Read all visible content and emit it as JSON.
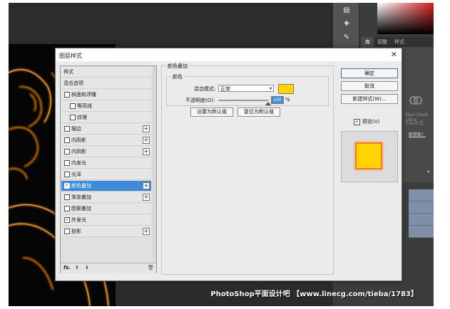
{
  "dialog": {
    "title": "图层样式",
    "close_glyph": "✕",
    "styles_header": "样式",
    "style_items": [
      {
        "label": "混合选项",
        "checkbox": false,
        "checked": false,
        "child": false,
        "plus": false,
        "selected": false
      },
      {
        "label": "斜面和浮雕",
        "checkbox": true,
        "checked": false,
        "child": false,
        "plus": false,
        "selected": false
      },
      {
        "label": "等高线",
        "checkbox": true,
        "checked": false,
        "child": true,
        "plus": false,
        "selected": false
      },
      {
        "label": "纹理",
        "checkbox": true,
        "checked": false,
        "child": true,
        "plus": false,
        "selected": false
      },
      {
        "label": "描边",
        "checkbox": true,
        "checked": false,
        "child": false,
        "plus": true,
        "selected": false
      },
      {
        "label": "内阴影",
        "checkbox": true,
        "checked": false,
        "child": false,
        "plus": true,
        "selected": false
      },
      {
        "label": "内阴影",
        "checkbox": true,
        "checked": false,
        "child": false,
        "plus": true,
        "selected": false
      },
      {
        "label": "内发光",
        "checkbox": true,
        "checked": false,
        "child": false,
        "plus": false,
        "selected": false
      },
      {
        "label": "光泽",
        "checkbox": true,
        "checked": false,
        "child": false,
        "plus": false,
        "selected": false
      },
      {
        "label": "颜色叠加",
        "checkbox": true,
        "checked": true,
        "child": false,
        "plus": true,
        "selected": true
      },
      {
        "label": "渐变叠加",
        "checkbox": true,
        "checked": false,
        "child": false,
        "plus": true,
        "selected": false
      },
      {
        "label": "图案叠加",
        "checkbox": true,
        "checked": false,
        "child": false,
        "plus": false,
        "selected": false
      },
      {
        "label": "外发光",
        "checkbox": true,
        "checked": true,
        "child": false,
        "plus": false,
        "selected": false
      },
      {
        "label": "投影",
        "checkbox": true,
        "checked": false,
        "child": false,
        "plus": true,
        "selected": false
      }
    ],
    "footer": {
      "fx": "fx.",
      "up": "⬆",
      "down": "⬇",
      "trash": "🗑"
    },
    "color_overlay": {
      "section_title": "颜色叠加",
      "group_title": "颜色",
      "blend_mode_label": "混合模式:",
      "blend_mode_value": "正常",
      "color_hex": "#ffd400",
      "opacity_label": "不透明度(O):",
      "opacity_value": "100",
      "opacity_unit": "%",
      "opacity_fraction": 1.0,
      "make_default_label": "设置为默认值",
      "reset_default_label": "复位为默认值"
    },
    "buttons": {
      "ok": "确定",
      "cancel": "取消",
      "new_style": "新建样式(W)...",
      "preview_label": "预览(V)",
      "preview_checked": true
    },
    "preview": {
      "fill": "#ffd400",
      "border": "#ff7a1a"
    }
  },
  "photoshop": {
    "panel_tabs": [
      "库",
      "调整",
      "样式"
    ],
    "library_lines": [
      "tive Cloud Libra",
      "Cloud 庄"
    ],
    "library_link": "即获取！",
    "dropdown_glyph": "▾"
  },
  "watermark": "PhotoShop平面设计吧 【www.linecg.com/tieba/1783】",
  "colors": {
    "selection": "#3d8bd8",
    "glow": "#ff8a00",
    "overlay": "#ffd400"
  }
}
